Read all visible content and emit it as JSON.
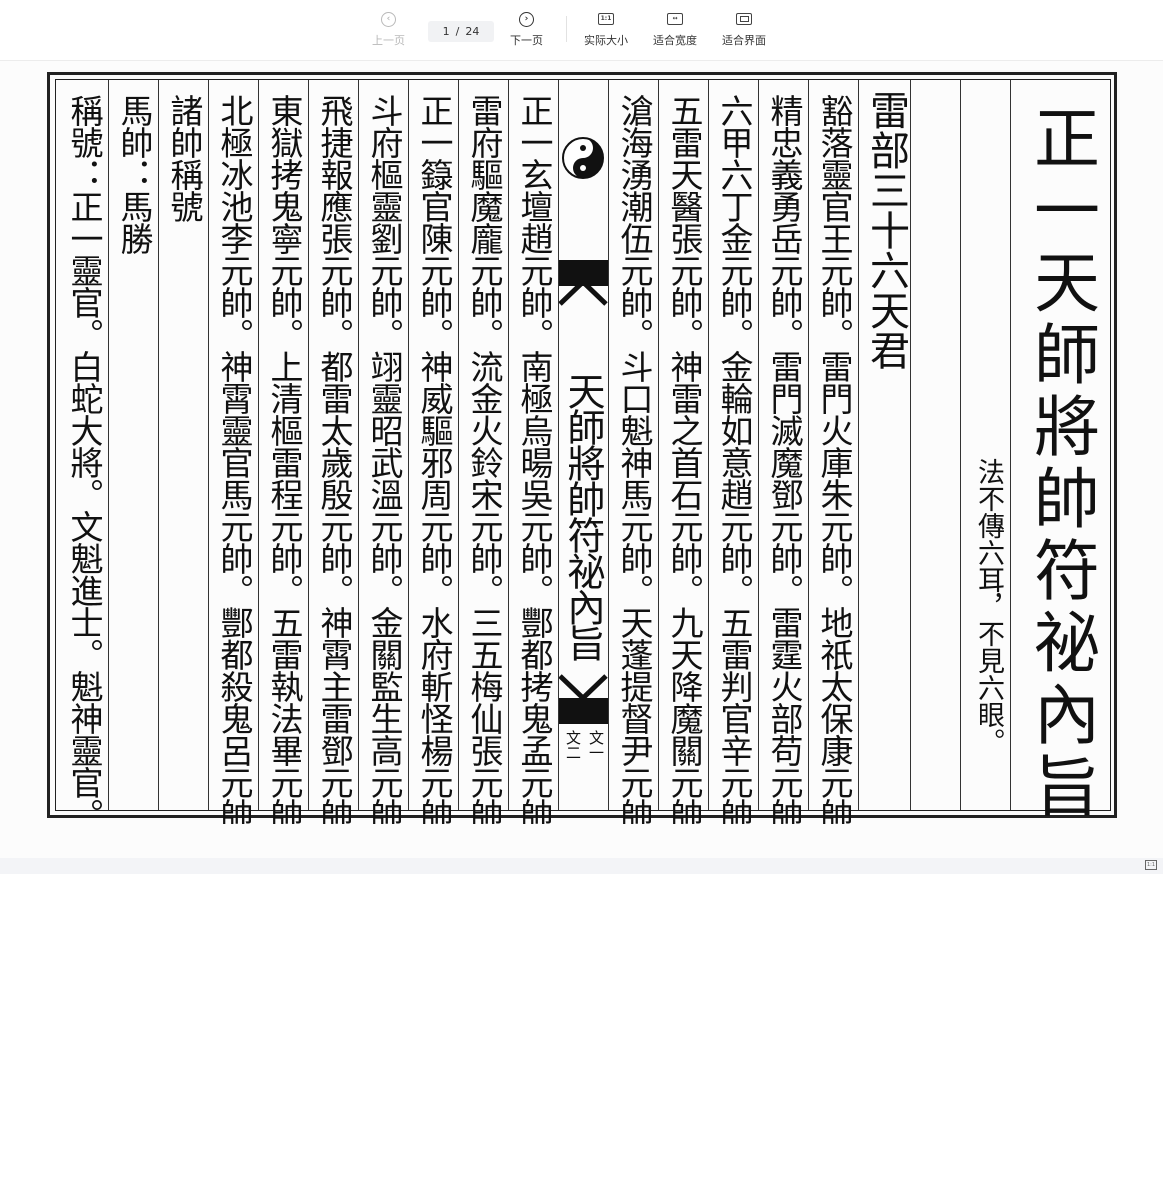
{
  "toolbar": {
    "prev": "上一页",
    "next": "下一页",
    "current_page": "1",
    "separator": "/",
    "total_pages": "24",
    "actual_size": "实际大小",
    "actual_size_icon": "1:1",
    "fit_width": "适合宽度",
    "fit_page": "适合界面"
  },
  "document": {
    "title": "正一天師將帥符祕內旨",
    "motto": "法不傳六耳，不見六眼。",
    "heading": "雷部三十六天君",
    "right_columns": [
      "豁落靈官王元帥。雷門火庫朱元帥。地祇太保康元帥。",
      "精忠義勇岳元帥。雷門滅魔鄧元帥。雷霆火部苟元帥。",
      "六甲六丁金元帥。金輪如意趙元帥。五雷判官辛元帥。",
      "五雷天醫張元帥。神雷之首石元帥。九天降魔關元帥。",
      "滄海湧潮伍元帥。斗口魁神馬元帥。天蓬提督尹元帥。"
    ],
    "center_title": "天師將帥符祕內旨",
    "center_label_1": "文一",
    "center_label_2": "文二",
    "left_columns": [
      "正一玄壇趙元帥。南極烏暘吳元帥。酆都拷鬼孟元帥。",
      "雷府驅魔龐元帥。流金火鈴宋元帥。三五梅仙張元帥。",
      "正一籙官陳元帥。神威驅邪周元帥。水府斬怪楊元帥。",
      "斗府樞靈劉元帥。翊靈昭武溫元帥。金關監生高元帥。",
      "飛捷報應張元帥。都雷太歲殷元帥。神霄主雷鄧元帥。",
      "東獄拷鬼寧元帥。上清樞雷程元帥。五雷執法畢元帥。",
      "北極冰池李元帥。神霄靈官馬元帥。酆都殺鬼呂元帥。"
    ],
    "section_heading": "諸帥稱號",
    "ma_line": "馬帥：馬勝",
    "last_line": "稱號：正一靈官。白蛇大將。文魁進士。魁神靈官。西乾法旨。"
  },
  "colors": {
    "ink": "#111111",
    "toolbar_disabled": "#b9b9b9"
  }
}
